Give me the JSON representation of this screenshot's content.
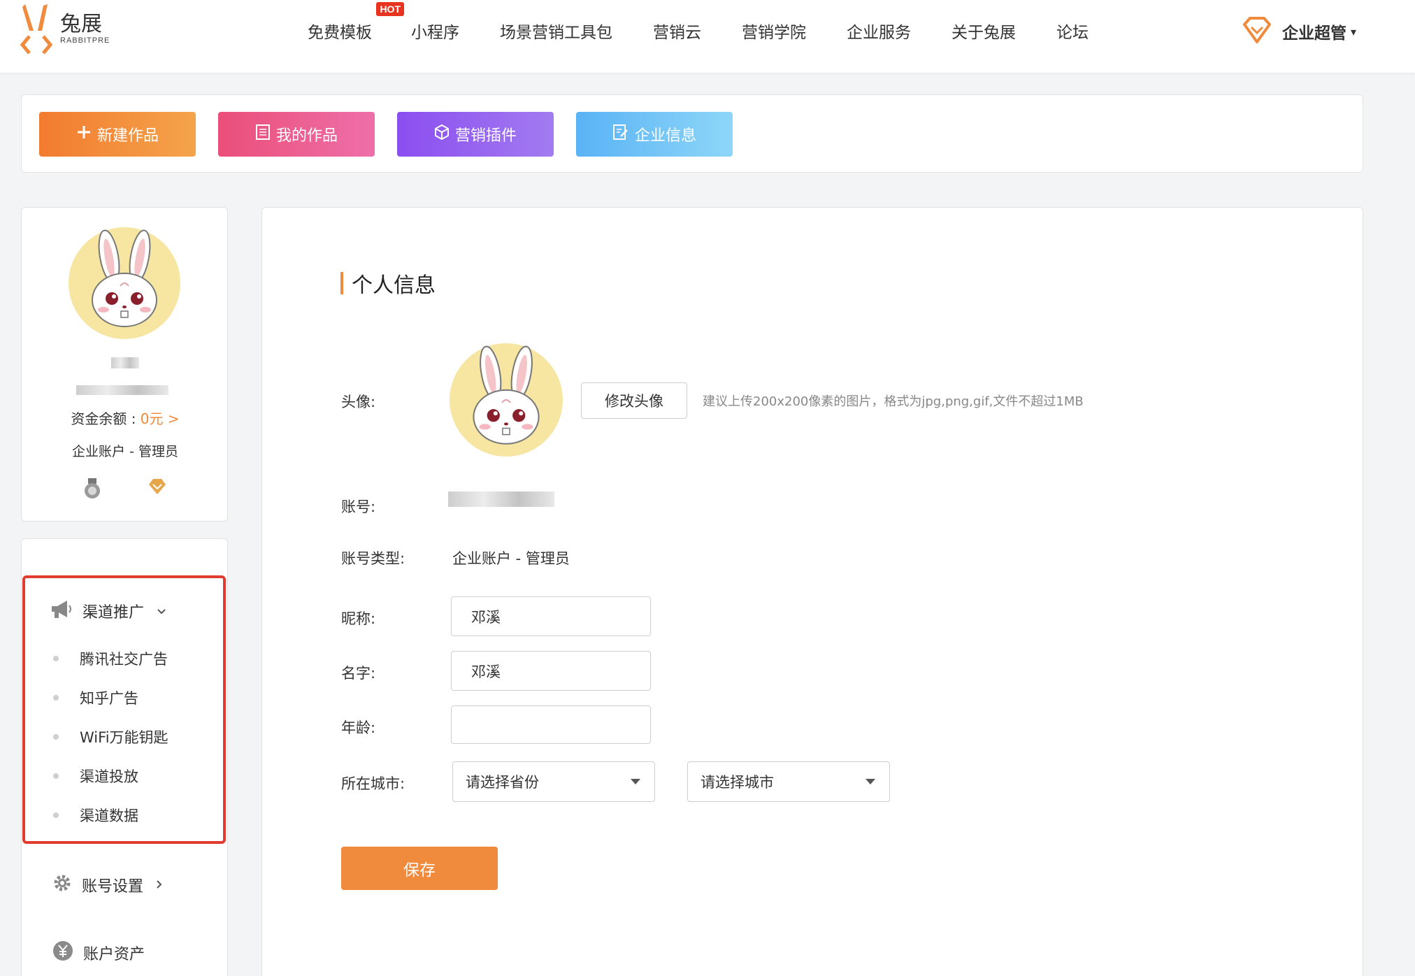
{
  "brand": {
    "name_cn": "兔展",
    "name_en": "RABBITPRE",
    "accent": "#f08a3c"
  },
  "nav": {
    "items": [
      {
        "label": "免费模板",
        "badge": "HOT"
      },
      {
        "label": "小程序"
      },
      {
        "label": "场景营销工具包"
      },
      {
        "label": "营销云"
      },
      {
        "label": "营销学院"
      },
      {
        "label": "企业服务"
      },
      {
        "label": "关于兔展"
      },
      {
        "label": "论坛"
      }
    ],
    "user_label": "企业超管",
    "user_caret": "▾"
  },
  "actions": {
    "new_work": "新建作品",
    "my_works": "我的作品",
    "marketing_plugins": "营销插件",
    "company_info": "企业信息"
  },
  "profile": {
    "balance_label": "资金余额 : ",
    "balance_value": "0元 >",
    "account_type": "企业账户 - 管理员"
  },
  "sidebar": {
    "channel_promo": {
      "label": "渠道推广",
      "items": [
        "腾讯社交广告",
        "知乎广告",
        "WiFi万能钥匙",
        "渠道投放",
        "渠道数据"
      ]
    },
    "account_settings": "账号设置",
    "account_assets": "账户资产"
  },
  "main": {
    "section_title": "个人信息",
    "avatar_label": "头像:",
    "change_avatar": "修改头像",
    "avatar_hint": "建议上传200x200像素的图片，格式为jpg,png,gif,文件不超过1MB",
    "account_label": "账号:",
    "account_type_label": "账号类型:",
    "account_type_value": "企业账户 - 管理员",
    "nickname_label": "昵称:",
    "nickname_value": "邓溪",
    "name_label": "名字:",
    "name_value": "邓溪",
    "age_label": "年龄:",
    "age_value": "",
    "city_label": "所在城市:",
    "province_placeholder": "请选择省份",
    "city_placeholder": "请选择城市",
    "save": "保存"
  }
}
